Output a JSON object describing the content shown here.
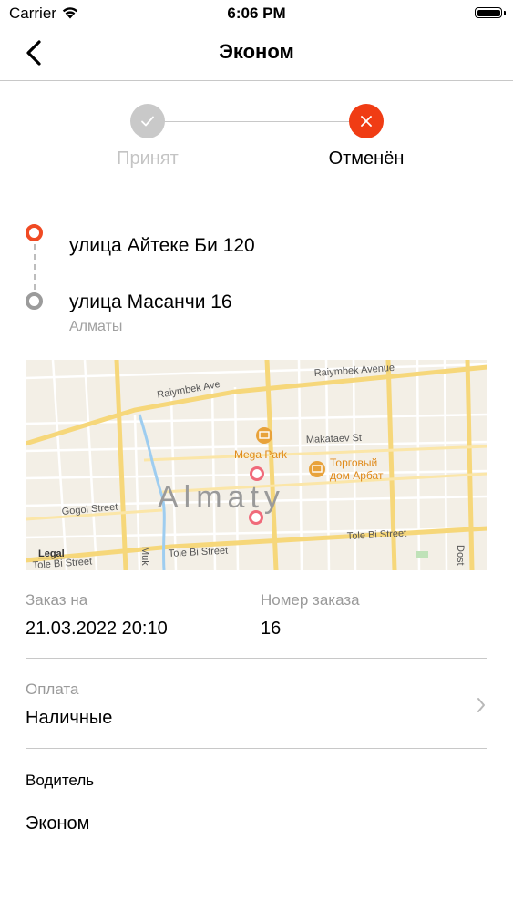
{
  "status_bar": {
    "carrier": "Carrier",
    "time": "6:06 PM"
  },
  "nav": {
    "title": "Эконом",
    "back_icon": "chevron-left-icon"
  },
  "progress": {
    "steps": [
      {
        "label": "Принят",
        "state": "done",
        "icon": "check-icon",
        "color": "#c9c9c9"
      },
      {
        "label": "Отменён",
        "state": "cancelled",
        "icon": "close-icon",
        "color": "#f03c14"
      }
    ]
  },
  "route": {
    "from": {
      "address": "улица Айтеке Би 120",
      "color": "#f04a23"
    },
    "to": {
      "address": "улица Масанчи 16",
      "city": "Алматы",
      "color": "#9b9b9b"
    }
  },
  "map": {
    "city_label": "Almaty",
    "legal": "Legal",
    "streets": [
      "Raiymbek Avenue",
      "Raiymbek Ave",
      "Makataev St",
      "Gogol Street",
      "Tole Bi Street",
      "Tole Bi Street",
      "Tole Bi Street",
      "Muk",
      "Dost"
    ],
    "pois": [
      "Mega Park",
      "Торговый",
      "дом Арбат"
    ],
    "poi_color": "#e8a23a",
    "marker_color": "#f06a7a"
  },
  "details": {
    "order_date_label": "Заказ на",
    "order_date_value": "21.03.2022 20:10",
    "order_number_label": "Номер заказа",
    "order_number_value": "16",
    "payment_label": "Оплата",
    "payment_value": "Наличные",
    "driver_label": "Водитель",
    "driver_value": "Эконом"
  }
}
